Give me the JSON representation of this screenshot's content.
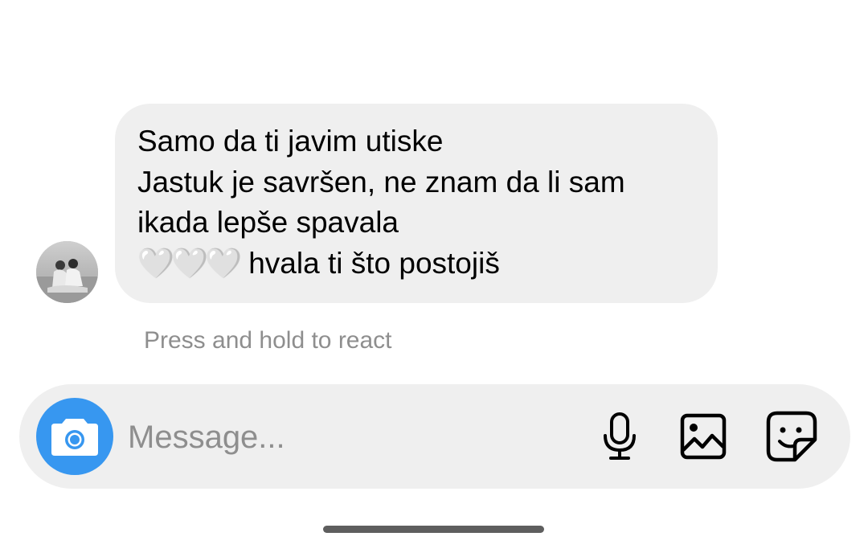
{
  "conversation": {
    "messages": [
      {
        "lines": [
          "Samo da ti javim utiske",
          "Jastuk je savršen, ne znam da li sam",
          "ikada lepše spavala"
        ],
        "emoji": "🤍🤍🤍",
        "last_line": "hvala ti što postojiš"
      }
    ],
    "react_hint": "Press and hold to react"
  },
  "composer": {
    "placeholder": "Message...",
    "value": ""
  },
  "icons": {
    "camera": "camera-icon",
    "mic": "microphone-icon",
    "gallery": "image-icon",
    "sticker": "sticker-icon"
  },
  "colors": {
    "accent": "#3797f0",
    "bubble": "#efefef",
    "composer_bg": "#efefef",
    "hint_text": "#8e8e8e"
  }
}
